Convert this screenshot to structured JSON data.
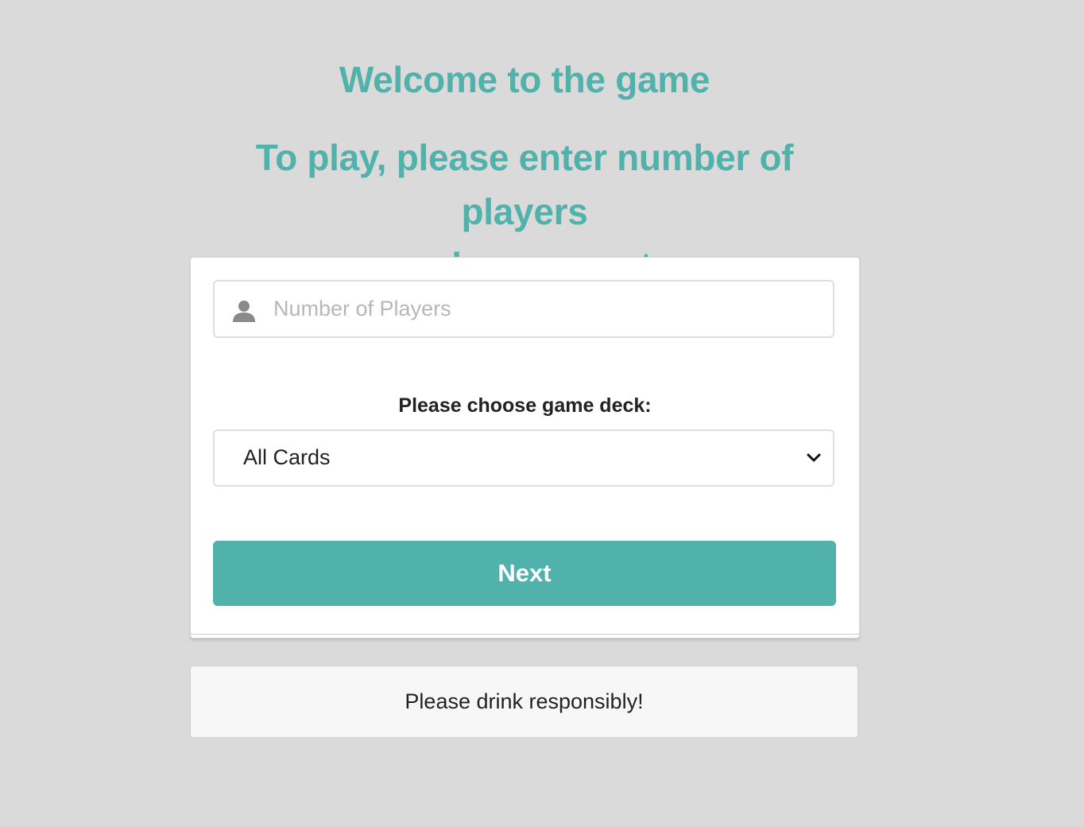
{
  "header": {
    "title": "Welcome to the game",
    "subtitle_line1": "To play, please enter number of players",
    "subtitle_line2": "and press next"
  },
  "form": {
    "players_input": {
      "icon": "user-icon",
      "placeholder": "Number of Players",
      "value": ""
    },
    "deck_label": "Please choose game deck:",
    "deck_select": {
      "selected": "All Cards",
      "icon": "chevron-down-icon"
    },
    "next_label": "Next"
  },
  "footer": {
    "message": "Please drink responsibly!"
  },
  "colors": {
    "accent": "#50b2ab",
    "background": "#dadada",
    "card": "#ffffff",
    "footer_box": "#f7f7f7"
  }
}
